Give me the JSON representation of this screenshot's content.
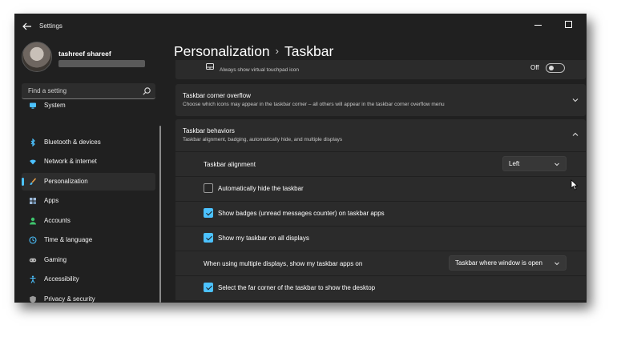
{
  "app": {
    "title": "Settings"
  },
  "user": {
    "name": "tashreef shareef"
  },
  "search": {
    "placeholder": "Find a setting"
  },
  "nav": {
    "items": [
      {
        "label": "System",
        "icon": "system-icon",
        "color": "#4cc2ff"
      },
      {
        "label": "Bluetooth & devices",
        "icon": "bluetooth-icon",
        "color": "#4cc2ff"
      },
      {
        "label": "Network & internet",
        "icon": "wifi-icon",
        "color": "#4cc2ff"
      },
      {
        "label": "Personalization",
        "icon": "brush-icon",
        "color": "#e8a04a",
        "active": true
      },
      {
        "label": "Apps",
        "icon": "apps-icon",
        "color": "#9ab8d8"
      },
      {
        "label": "Accounts",
        "icon": "accounts-icon",
        "color": "#3ec46d"
      },
      {
        "label": "Time & language",
        "icon": "clock-globe-icon",
        "color": "#4cc2ff"
      },
      {
        "label": "Gaming",
        "icon": "gamepad-icon",
        "color": "#bdbdbd"
      },
      {
        "label": "Accessibility",
        "icon": "accessibility-icon",
        "color": "#4cc2ff"
      },
      {
        "label": "Privacy & security",
        "icon": "shield-icon",
        "color": "#9a9a9a"
      }
    ]
  },
  "header": {
    "section": "Personalization",
    "page": "Taskbar"
  },
  "partial_row": {
    "desc": "Always show virtual touchpad icon",
    "toggle_label": "Off"
  },
  "corner_overflow": {
    "title": "Taskbar corner overflow",
    "desc": "Choose which icons may appear in the taskbar corner – all others will appear in the taskbar corner overflow menu"
  },
  "behaviors": {
    "title": "Taskbar behaviors",
    "desc": "Taskbar alignment, badging, automatically hide, and multiple displays",
    "alignment": {
      "label": "Taskbar alignment",
      "value": "Left"
    },
    "autohide": {
      "label": "Automatically hide the taskbar",
      "checked": false
    },
    "badges": {
      "label": "Show badges (unread messages counter) on taskbar apps",
      "checked": true
    },
    "all_displays": {
      "label": "Show my taskbar on all displays",
      "checked": true
    },
    "multi_display": {
      "label": "When using multiple displays, show my taskbar apps on",
      "value": "Taskbar where window is open"
    },
    "far_corner": {
      "label": "Select the far corner of the taskbar to show the desktop",
      "checked": true
    }
  },
  "colors": {
    "accent": "#4cc2ff",
    "window_bg": "#202020",
    "card_bg": "#2b2b2b"
  }
}
